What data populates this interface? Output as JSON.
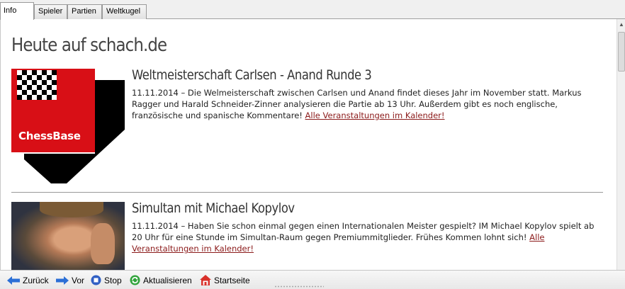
{
  "tabs": [
    {
      "label": "Info",
      "active": true
    },
    {
      "label": "Spieler",
      "active": false
    },
    {
      "label": "Partien",
      "active": false
    },
    {
      "label": "Weltkugel",
      "active": false
    }
  ],
  "page": {
    "title": "Heute auf schach.de"
  },
  "news": [
    {
      "headline": "Weltmeisterschaft Carlsen - Anand Runde 3",
      "text": "11.11.2014 – Die Welmeisterschaft zwischen Carlsen und Anand findet dieses Jahr im November statt. Markus Ragger und Harald Schneider-Zinner analysieren die Partie ab 13 Uhr. Außerdem gibt es noch englische, französische und spanische Kommentare!",
      "link": "Alle Veranstaltungen im Kalender!",
      "thumb_label": "ChessBase"
    },
    {
      "headline": "Simultan mit Michael Kopylov",
      "text": "11.11.2014 – Haben Sie schon einmal gegen einen Internationalen Meister gespielt? IM Michael Kopylov spielt ab 20 Uhr für eine Stunde im Simultan-Raum gegen Premiummitglieder. Frühes Kommen lohnt sich!",
      "link": "Alle Veranstaltungen im Kalender!"
    }
  ],
  "toolbar": {
    "back": {
      "label": "Zurück",
      "icon": "arrow-left-icon"
    },
    "forward": {
      "label": "Vor",
      "icon": "arrow-right-icon"
    },
    "stop": {
      "label": "Stop",
      "icon": "stop-icon"
    },
    "refresh": {
      "label": "Aktualisieren",
      "icon": "refresh-icon"
    },
    "home": {
      "label": "Startseite",
      "icon": "home-icon"
    }
  },
  "colors": {
    "link": "#8b1a1a",
    "logo_red": "#d80f16",
    "arrow_blue": "#2b6fd6",
    "refresh_green": "#2fa33a"
  }
}
